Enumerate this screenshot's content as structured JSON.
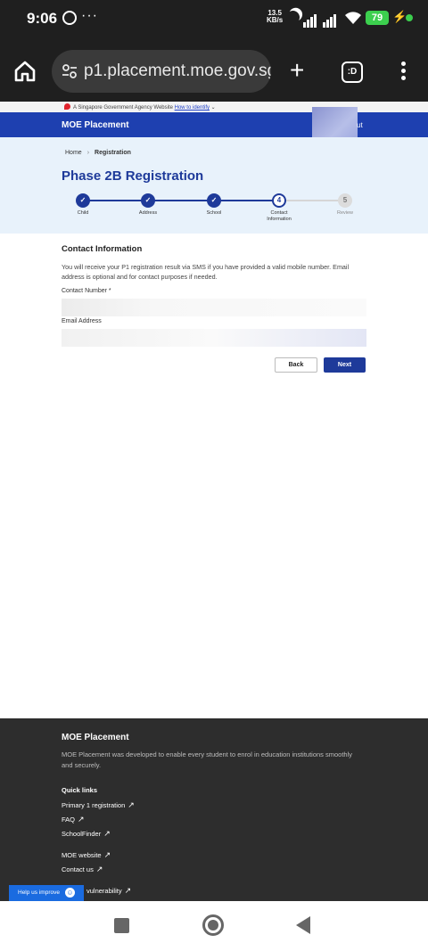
{
  "status_bar": {
    "time": "9:06",
    "net_speed": "13.5",
    "net_unit": "KB/s",
    "battery": "79"
  },
  "browser": {
    "url": "p1.placement.moe.gov.sg/",
    "tab_count": ":D"
  },
  "gov_banner": {
    "text": "A Singapore Government Agency Website",
    "link": "How to identify"
  },
  "header": {
    "brand": "MOE Placement",
    "logout_fragment": "ut"
  },
  "breadcrumb": {
    "home": "Home",
    "current": "Registration"
  },
  "page_title": "Phase 2B Registration",
  "steps": [
    {
      "label": "Child",
      "state": "done",
      "num": "✓"
    },
    {
      "label": "Address",
      "state": "done",
      "num": "✓"
    },
    {
      "label": "School",
      "state": "done",
      "num": "✓"
    },
    {
      "label": "Contact Information",
      "state": "active",
      "num": "4"
    },
    {
      "label": "Review",
      "state": "todo",
      "num": "5"
    }
  ],
  "form": {
    "section_title": "Contact Information",
    "description": "You will receive your P1 registration result via SMS if you have provided a valid mobile number. Email address is optional and for contact purposes if needed.",
    "contact_label": "Contact Number *",
    "contact_value": "",
    "email_label": "Email Address",
    "email_value": "",
    "back_label": "Back",
    "next_label": "Next"
  },
  "footer": {
    "title": "MOE Placement",
    "description": "MOE Placement was developed to enable every student to enrol in education institutions smoothly and securely.",
    "quick_links_title": "Quick links",
    "links": [
      "Primary 1 registration",
      "FAQ",
      "SchoolFinder",
      "MOE website",
      "Contact us",
      "vulnerability"
    ],
    "help_label": "Help us improve"
  },
  "colors": {
    "brand": "#1e40b0",
    "primary": "#1e3a9a",
    "hero_bg": "#e8f2fb",
    "footer_bg": "#2d2d2d"
  }
}
